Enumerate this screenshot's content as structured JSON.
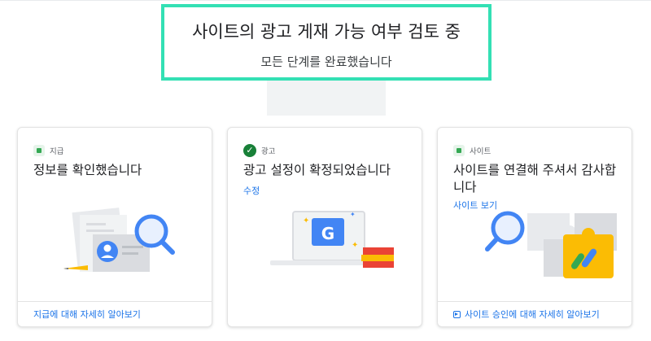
{
  "banner": {
    "title": "사이트의 광고 게재 가능 여부 검토 중",
    "subtitle": "모든 단계를 완료했습니다"
  },
  "cards": [
    {
      "status_icon": "green-square-icon",
      "status_label": "지급",
      "title": "정보를 확인했습니다",
      "link": "",
      "footer": "지급에 대해 자세히 알아보기"
    },
    {
      "status_icon": "check-circle-icon",
      "status_label": "광고",
      "title": "광고 설정이 확정되었습니다",
      "link": "수정",
      "illustration_letter": "G",
      "footer": ""
    },
    {
      "status_icon": "green-square-icon",
      "status_label": "사이트",
      "title": "사이트를 연결해 주셔서 감사합니다",
      "link": "사이트 보기",
      "footer": "사이트 승인에 대해 자세히 알아보기"
    }
  ],
  "colors": {
    "banner_border": "#33e0b4",
    "link": "#1a73e8",
    "success": "#188038",
    "google_blue": "#4285f4",
    "adsense_yellow": "#fbbc04"
  }
}
